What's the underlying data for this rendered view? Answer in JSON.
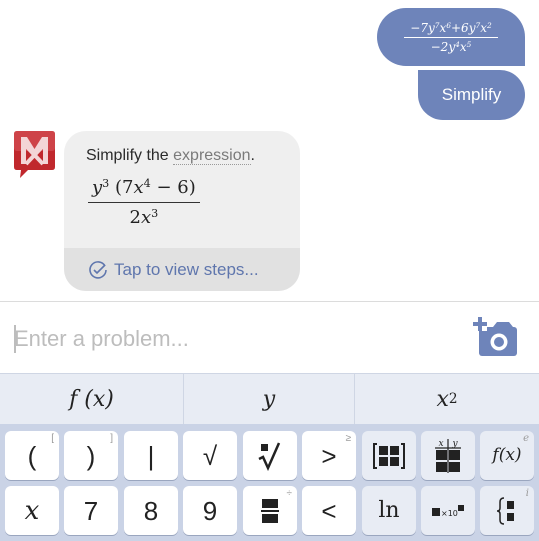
{
  "conversation": {
    "user_expression": {
      "numerator": "−7y⁷x⁶+6y⁷x²",
      "numerator_parts": [
        "−7",
        "y",
        "7",
        "x",
        "6",
        "+6",
        "y",
        "7",
        "x",
        "2"
      ],
      "denominator_parts": [
        "−2",
        "y",
        "4",
        "x",
        "5"
      ]
    },
    "user_command": "Simplify",
    "bot": {
      "avatar_icon": "mathway-logo-icon",
      "intro_text": "Simplify the",
      "intro_link": "expression",
      "intro_end": ".",
      "result_numerator_parts": [
        "y",
        "3",
        " (7",
        "x",
        "4",
        " − 6)"
      ],
      "result_denominator_parts": [
        "2",
        "x",
        "3"
      ],
      "steps_icon": "check-circle-icon",
      "steps_label": "Tap to view steps..."
    }
  },
  "input": {
    "placeholder": "Enter a problem...",
    "value": "",
    "camera_icon": "add-photo-camera-icon"
  },
  "keyboard": {
    "tabs": [
      {
        "label": "f (x)"
      },
      {
        "label": "y"
      },
      {
        "label": "x",
        "sup": "2"
      }
    ],
    "rows": [
      [
        {
          "label": "(",
          "secondary": "["
        },
        {
          "label": ")",
          "secondary": "]"
        },
        {
          "label": "|",
          "secondary": ""
        },
        {
          "label": "√",
          "secondary": ""
        },
        {
          "label": "ⁿ√",
          "icon": "nth-root-icon",
          "secondary": ""
        },
        {
          "label": ">",
          "secondary": "≥"
        },
        {
          "label": "[▦]",
          "icon": "matrix-icon",
          "secondary": ""
        },
        {
          "label": "x|y",
          "icon": "table-icon",
          "secondary": ""
        },
        {
          "label": "f(x)",
          "secondary": "e"
        }
      ],
      [
        {
          "label": "x",
          "secondary": ""
        },
        {
          "label": "7",
          "secondary": ""
        },
        {
          "label": "8",
          "secondary": ""
        },
        {
          "label": "9",
          "secondary": ""
        },
        {
          "label": "▬/▬",
          "icon": "fraction-icon",
          "secondary": "÷"
        },
        {
          "label": "<",
          "secondary": ""
        },
        {
          "label": "ln",
          "secondary": ""
        },
        {
          "label": "■×10■",
          "icon": "scientific-notation-icon",
          "secondary": ""
        },
        {
          "label": "{▪",
          "icon": "piecewise-icon",
          "secondary": "i"
        }
      ]
    ]
  },
  "colors": {
    "accent": "#6e84ba",
    "bot_card": "#efefef",
    "steps_bar": "#e1e1e1",
    "steps_text": "#5f76ad",
    "logo_red": "#c0282d",
    "keypad_bg": "#cad3e6",
    "tab_bg": "#e8ecf4"
  }
}
